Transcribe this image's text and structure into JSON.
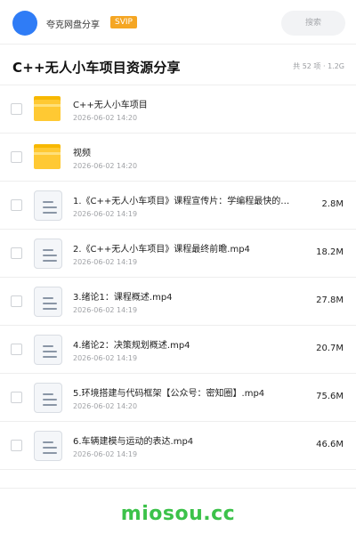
{
  "header": {
    "brand": "夸克网盘分享",
    "badge": "SVIP",
    "search_placeholder": "搜索"
  },
  "share": {
    "title": "C++无人小车项目资源分享",
    "meta": "共 52 项 · 1.2G"
  },
  "files": [
    {
      "type": "folder",
      "name": "C++无人小车项目",
      "date": "2026-06-02 14:20",
      "size": ""
    },
    {
      "type": "folder",
      "name": "视频",
      "date": "2026-06-02 14:20",
      "size": ""
    },
    {
      "type": "file",
      "name": "1.《C++无人小车项目》课程宣传片：学编程最快的…",
      "date": "2026-06-02 14:19",
      "size": "2.8M"
    },
    {
      "type": "file",
      "name": "2.《C++无人小车项目》课程最终前瞻.mp4",
      "date": "2026-06-02 14:19",
      "size": "18.2M"
    },
    {
      "type": "file",
      "name": "3.绪论1：课程概述.mp4",
      "date": "2026-06-02 14:19",
      "size": "27.8M"
    },
    {
      "type": "file",
      "name": "4.绪论2：决策规划概述.mp4",
      "date": "2026-06-02 14:19",
      "size": "20.7M"
    },
    {
      "type": "file",
      "name": "5.环境搭建与代码框架【公众号：密知圈】.mp4",
      "date": "2026-06-02 14:20",
      "size": "75.6M"
    },
    {
      "type": "file",
      "name": "6.车辆建模与运动的表达.mp4",
      "date": "2026-06-02 14:19",
      "size": "46.6M"
    }
  ],
  "footer": {
    "watermark": "miosou.cc"
  },
  "colors": {
    "avatar": "#2f7cf6",
    "badge": "#f5a623",
    "folder": "#ffc933",
    "watermark": "#3cc24a"
  }
}
